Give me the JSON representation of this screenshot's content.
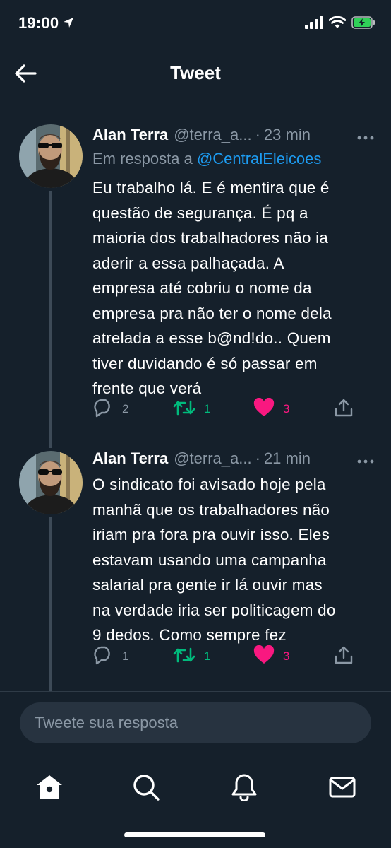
{
  "status_bar": {
    "time": "19:00",
    "icons": [
      "location-arrow-icon",
      "signal-bars-icon",
      "wifi-icon",
      "battery-charging-icon"
    ]
  },
  "header": {
    "title": "Tweet",
    "back_icon": "back-arrow-icon"
  },
  "tweets": [
    {
      "author_name": "Alan Terra",
      "handle": "@terra_a...",
      "time_ago": "23 min",
      "reply_prefix": "Em resposta a ",
      "reply_to": "@CentralEleicoes",
      "text": "Eu trabalho lá. E é mentira que é\nquestão de segurança. É pq a\nmaioria dos trabalhadores não ia\naderir a essa palhaçada. A\nempresa até cobriu o nome da\nempresa pra não ter o nome dela\natrelada a esse b@nd!do.. Quem\ntiver duvidando é só passar em\nfrente que verá",
      "replies": "2",
      "retweets": "1",
      "likes": "3",
      "liked": true
    },
    {
      "author_name": "Alan Terra",
      "handle": "@terra_a...",
      "time_ago": "21 min",
      "text": "O sindicato foi avisado hoje pela\nmanhã que os trabalhadores não\niriam pra fora pra ouvir isso. Eles\nestavam usando uma campanha\nsalarial pra gente ir lá ouvir mas\nna verdade iria ser politicagem do\n9 dedos. Como sempre fez",
      "replies": "1",
      "retweets": "1",
      "likes": "3",
      "liked": true
    }
  ],
  "composer": {
    "placeholder": "Tweete sua resposta"
  },
  "tabbar": {
    "items": [
      "home-icon",
      "search-icon",
      "notifications-bell-icon",
      "messages-mail-icon"
    ]
  },
  "colors": {
    "background": "#15202b",
    "accent": "#1d9bf0",
    "retweet": "#00ba7c",
    "like": "#f91880",
    "muted": "#8b98a5"
  }
}
